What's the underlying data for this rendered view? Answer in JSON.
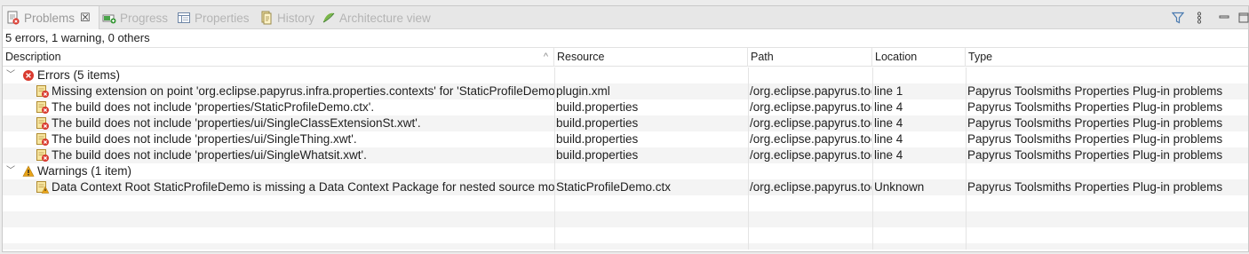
{
  "tabs": [
    {
      "label": "Problems",
      "icon": "problems-icon",
      "active": true
    },
    {
      "label": "Progress",
      "icon": "progress-icon"
    },
    {
      "label": "Properties",
      "icon": "properties-icon"
    },
    {
      "label": "History",
      "icon": "history-icon"
    },
    {
      "label": "Architecture view",
      "icon": "architecture-view-icon"
    }
  ],
  "toolbar": {
    "filter": "filter-icon",
    "view_menu": "view-menu-icon",
    "minimize": "minimize-icon",
    "maximize": "maximize-icon"
  },
  "summary": "5 errors, 1 warning, 0 others",
  "columns": [
    "Description",
    "Resource",
    "Path",
    "Location",
    "Type"
  ],
  "groups": [
    {
      "label": "Errors (5 items)",
      "kind": "error",
      "items": [
        {
          "description": "Missing extension on point 'org.eclipse.papyrus.infra.properties.contexts' for 'StaticProfileDemo.ctx'",
          "resource": "plugin.xml",
          "path": "/org.eclipse.papyrus.toolsmiths",
          "location": "line 1",
          "type": "Papyrus Toolsmiths Properties Plug-in problems"
        },
        {
          "description": "The build does not include 'properties/StaticProfileDemo.ctx'.",
          "resource": "build.properties",
          "path": "/org.eclipse.papyrus.toolsmiths",
          "location": "line 4",
          "type": "Papyrus Toolsmiths Properties Plug-in problems"
        },
        {
          "description": "The build does not include 'properties/ui/SingleClassExtensionSt.xwt'.",
          "resource": "build.properties",
          "path": "/org.eclipse.papyrus.toolsmiths",
          "location": "line 4",
          "type": "Papyrus Toolsmiths Properties Plug-in problems"
        },
        {
          "description": "The build does not include 'properties/ui/SingleThing.xwt'.",
          "resource": "build.properties",
          "path": "/org.eclipse.papyrus.toolsmiths",
          "location": "line 4",
          "type": "Papyrus Toolsmiths Properties Plug-in problems"
        },
        {
          "description": "The build does not include 'properties/ui/SingleWhatsit.xwt'.",
          "resource": "build.properties",
          "path": "/org.eclipse.papyrus.toolsmiths",
          "location": "line 4",
          "type": "Papyrus Toolsmiths Properties Plug-in problems"
        }
      ]
    },
    {
      "label": "Warnings (1 item)",
      "kind": "warning",
      "items": [
        {
          "description": "Data Context Root StaticProfileDemo is missing a Data Context Package for nested source model",
          "resource": "StaticProfileDemo.ctx",
          "path": "/org.eclipse.papyrus.toolsmiths",
          "location": "Unknown",
          "type": "Papyrus Toolsmiths Properties Plug-in problems"
        }
      ]
    }
  ],
  "colors": {
    "error": "#d93a2f",
    "warning": "#e8a317",
    "row_alt": "#f4f4f4"
  }
}
